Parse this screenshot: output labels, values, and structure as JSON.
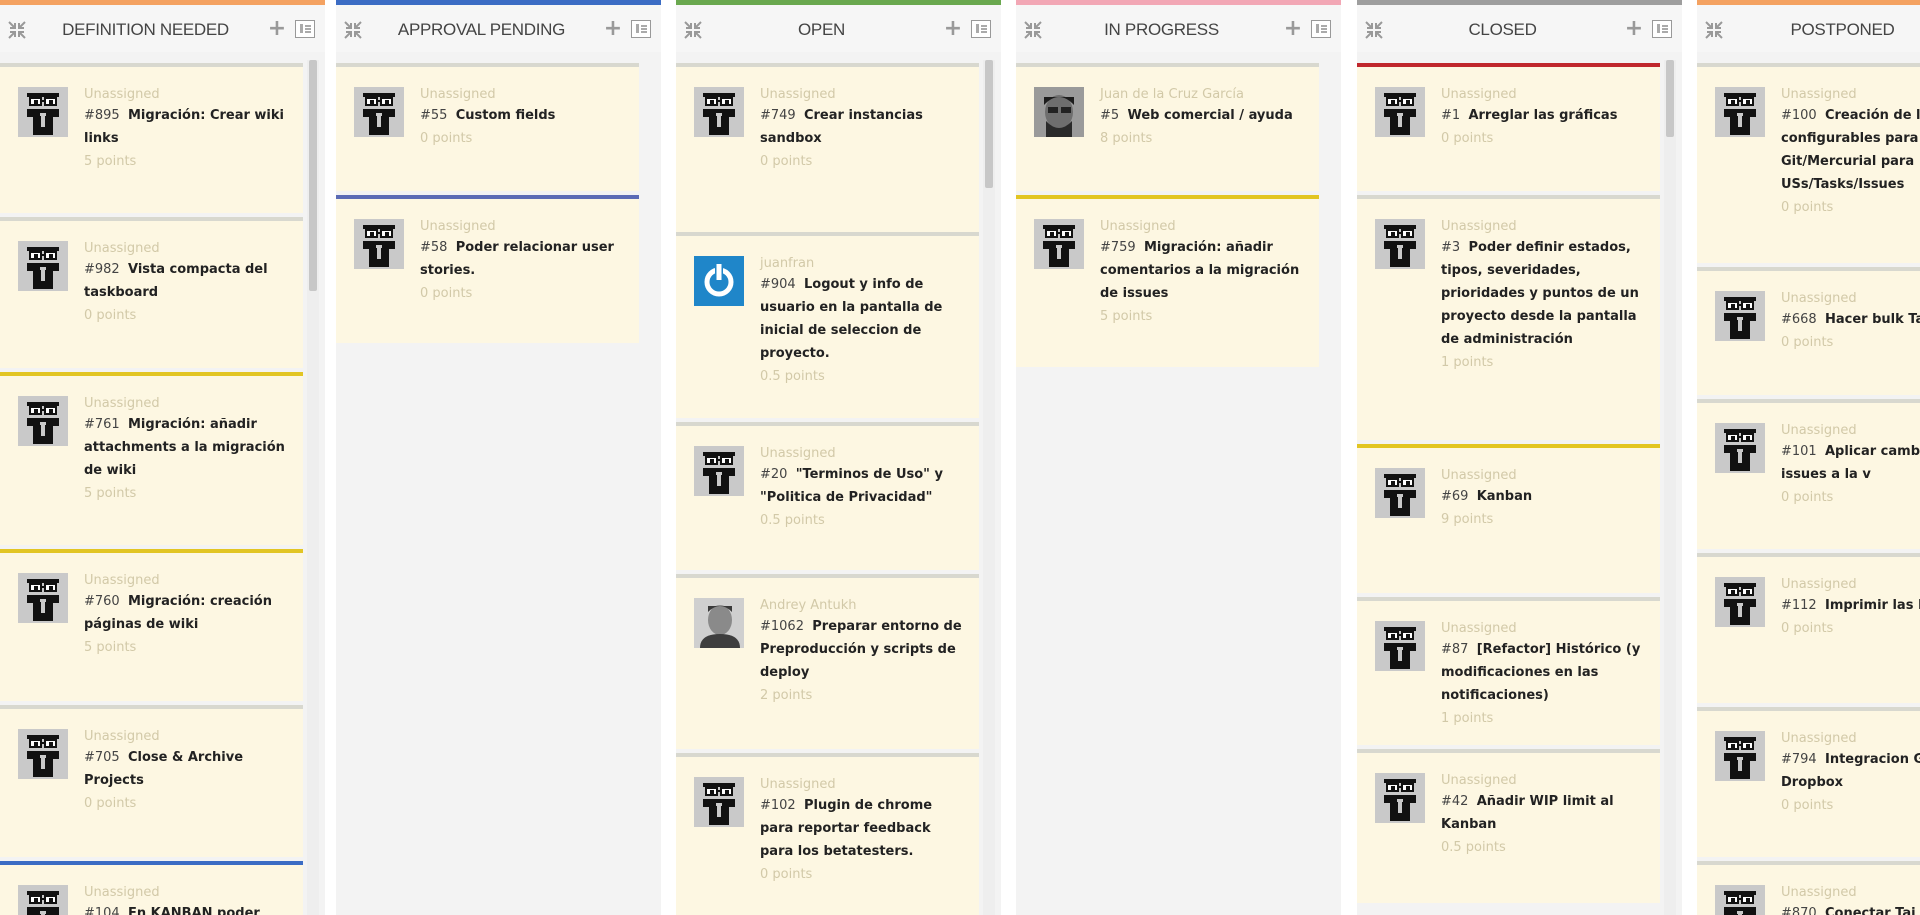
{
  "columns": [
    {
      "title": "DEFINITION NEEDED",
      "color": "#f4a261",
      "scroll_top": 0.0,
      "scroll_size": 0.27,
      "cards": [
        {
          "assignee": "Unassigned",
          "ref": "#895",
          "subject": "Migración: Crear wiki links",
          "points": "5 points",
          "top_color": "#d8d8cf",
          "avatar": "default"
        },
        {
          "assignee": "Unassigned",
          "ref": "#982",
          "subject": "Vista compacta del taskboard",
          "points": "0 points",
          "top_color": "#d8d8cf",
          "avatar": "default"
        },
        {
          "assignee": "Unassigned",
          "ref": "#761",
          "subject": "Migración: añadir attachments a la migración de wiki",
          "points": "5 points",
          "top_color": "#e2c523",
          "avatar": "default"
        },
        {
          "assignee": "Unassigned",
          "ref": "#760",
          "subject": "Migración: creación páginas de wiki",
          "points": "5 points",
          "top_color": "#e2c523",
          "avatar": "default"
        },
        {
          "assignee": "Unassigned",
          "ref": "#705",
          "subject": "Close & Archive Projects",
          "points": "0 points",
          "top_color": "#d8d8cf",
          "avatar": "default"
        },
        {
          "assignee": "Unassigned",
          "ref": "#104",
          "subject": "En KANBAN poder",
          "points": "",
          "top_color": "#3b6cc4",
          "avatar": "default"
        }
      ]
    },
    {
      "title": "APPROVAL PENDING",
      "color": "#3b6cc4",
      "cards": [
        {
          "assignee": "Unassigned",
          "ref": "#55",
          "subject": "Custom fields",
          "points": "0 points",
          "top_color": "#d8d8cf",
          "avatar": "default"
        },
        {
          "assignee": "Unassigned",
          "ref": "#58",
          "subject": "Poder relacionar user stories.",
          "points": "0 points",
          "top_color": "#5b6bb5",
          "avatar": "default"
        }
      ]
    },
    {
      "title": "OPEN",
      "color": "#6aa84f",
      "scroll_top": 0.0,
      "scroll_size": 0.15,
      "cards": [
        {
          "assignee": "Unassigned",
          "ref": "#749",
          "subject": "Crear instancias sandbox",
          "points": "0 points",
          "top_color": "#d8d8cf",
          "avatar": "default"
        },
        {
          "assignee": "juanfran",
          "ref": "#904",
          "subject": "Logout y info de usuario en la pantalla de inicial de seleccion de proyecto.",
          "points": "0.5 points",
          "top_color": "#d8d8cf",
          "avatar": "power"
        },
        {
          "assignee": "Unassigned",
          "ref": "#20",
          "subject": "\"Terminos de Uso\" y \"Politica de Privacidad\"",
          "points": "0.5 points",
          "top_color": "#d8d8cf",
          "avatar": "default"
        },
        {
          "assignee": "Andrey Antukh",
          "ref": "#1062",
          "subject": "Preparar entorno de Preproducción y scripts de deploy",
          "points": "2 points",
          "top_color": "#d8d8cf",
          "avatar": "photo-b"
        },
        {
          "assignee": "Unassigned",
          "ref": "#102",
          "subject": "Plugin de chrome para reportar feedback para los betatesters.",
          "points": "0 points",
          "top_color": "#d8d8cf",
          "avatar": "default"
        }
      ]
    },
    {
      "title": "IN PROGRESS",
      "color": "#f2a7b5",
      "cards": [
        {
          "assignee": "Juan de la Cruz García",
          "ref": "#5",
          "subject": "Web comercial / ayuda",
          "points": "8 points",
          "top_color": "#d8d8cf",
          "avatar": "photo-a"
        },
        {
          "assignee": "Unassigned",
          "ref": "#759",
          "subject": "Migración: añadir comentarios a la migración de issues",
          "points": "5 points",
          "top_color": "#e2c523",
          "avatar": "default"
        }
      ]
    },
    {
      "title": "CLOSED",
      "color": "#9e9e9e",
      "scroll_top": 0.0,
      "scroll_size": 0.09,
      "cards": [
        {
          "assignee": "Unassigned",
          "ref": "#1",
          "subject": "Arreglar las gráficas",
          "points": "0 points",
          "top_color": "#c0272d",
          "avatar": "default"
        },
        {
          "assignee": "Unassigned",
          "ref": "#3",
          "subject": "Poder definir estados, tipos, severidades, prioridades y puntos de un proyecto desde la pantalla de administración",
          "points": "1 points",
          "top_color": "#d8d8cf",
          "avatar": "default"
        },
        {
          "assignee": "Unassigned",
          "ref": "#69",
          "subject": "Kanban",
          "points": "9 points",
          "top_color": "#e2c523",
          "avatar": "default"
        },
        {
          "assignee": "Unassigned",
          "ref": "#87",
          "subject": "[Refactor] Histórico (y modificaciones en las notificaciones)",
          "points": "1 points",
          "top_color": "#d8d8cf",
          "avatar": "default"
        },
        {
          "assignee": "Unassigned",
          "ref": "#42",
          "subject": "Añadir WIP limit al Kanban",
          "points": "0.5 points",
          "top_color": "#d8d8cf",
          "avatar": "default"
        }
      ]
    },
    {
      "title": "POSTPONED",
      "color": "#f4a261",
      "cards": [
        {
          "assignee": "Unassigned",
          "ref": "#100",
          "subject": "Creación de l configurables para Git/Mercurial para USs/Tasks/Issues",
          "points": "0 points",
          "top_color": "#d8d8cf",
          "avatar": "default"
        },
        {
          "assignee": "Unassigned",
          "ref": "#668",
          "subject": "Hacer bulk Ta",
          "points": "0 points",
          "top_color": "#d8d8cf",
          "avatar": "default"
        },
        {
          "assignee": "Unassigned",
          "ref": "#101",
          "subject": "Aplicar camb varias issues a la v",
          "points": "0 points",
          "top_color": "#d8d8cf",
          "avatar": "default"
        },
        {
          "assignee": "Unassigned",
          "ref": "#112",
          "subject": "Imprimir las Kanban",
          "points": "0 points",
          "top_color": "#d8d8cf",
          "avatar": "default"
        },
        {
          "assignee": "Unassigned",
          "ref": "#794",
          "subject": "Integracion Google y Dropbox",
          "points": "0 points",
          "top_color": "#d8d8cf",
          "avatar": "default"
        },
        {
          "assignee": "Unassigned",
          "ref": "#870",
          "subject": "Conectar Tai",
          "points": "",
          "top_color": "#d8d8cf",
          "avatar": "default"
        }
      ]
    }
  ]
}
